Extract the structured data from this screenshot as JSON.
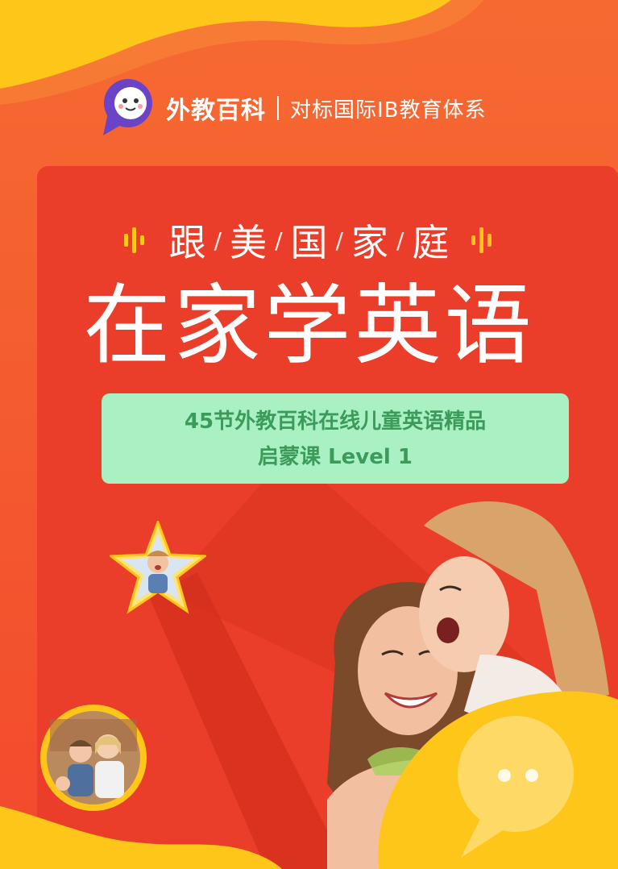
{
  "brand": {
    "name": "外教百科",
    "tagline": "对标国际IB教育体系"
  },
  "headline": {
    "subtitle_chars": [
      "跟",
      "美",
      "国",
      "家",
      "庭"
    ],
    "title": "在家学英语"
  },
  "course": {
    "line1": "45节外教百科在线儿童英语精品",
    "line2": "启蒙课 Level 1"
  },
  "colors": {
    "background_orange": "#f2582b",
    "panel_red": "#eb3e2a",
    "accent_yellow": "#ffc61a",
    "course_box_green": "#a9f1c2",
    "course_text_green": "#3c9a5a",
    "logo_purple": "#6b43c7"
  }
}
